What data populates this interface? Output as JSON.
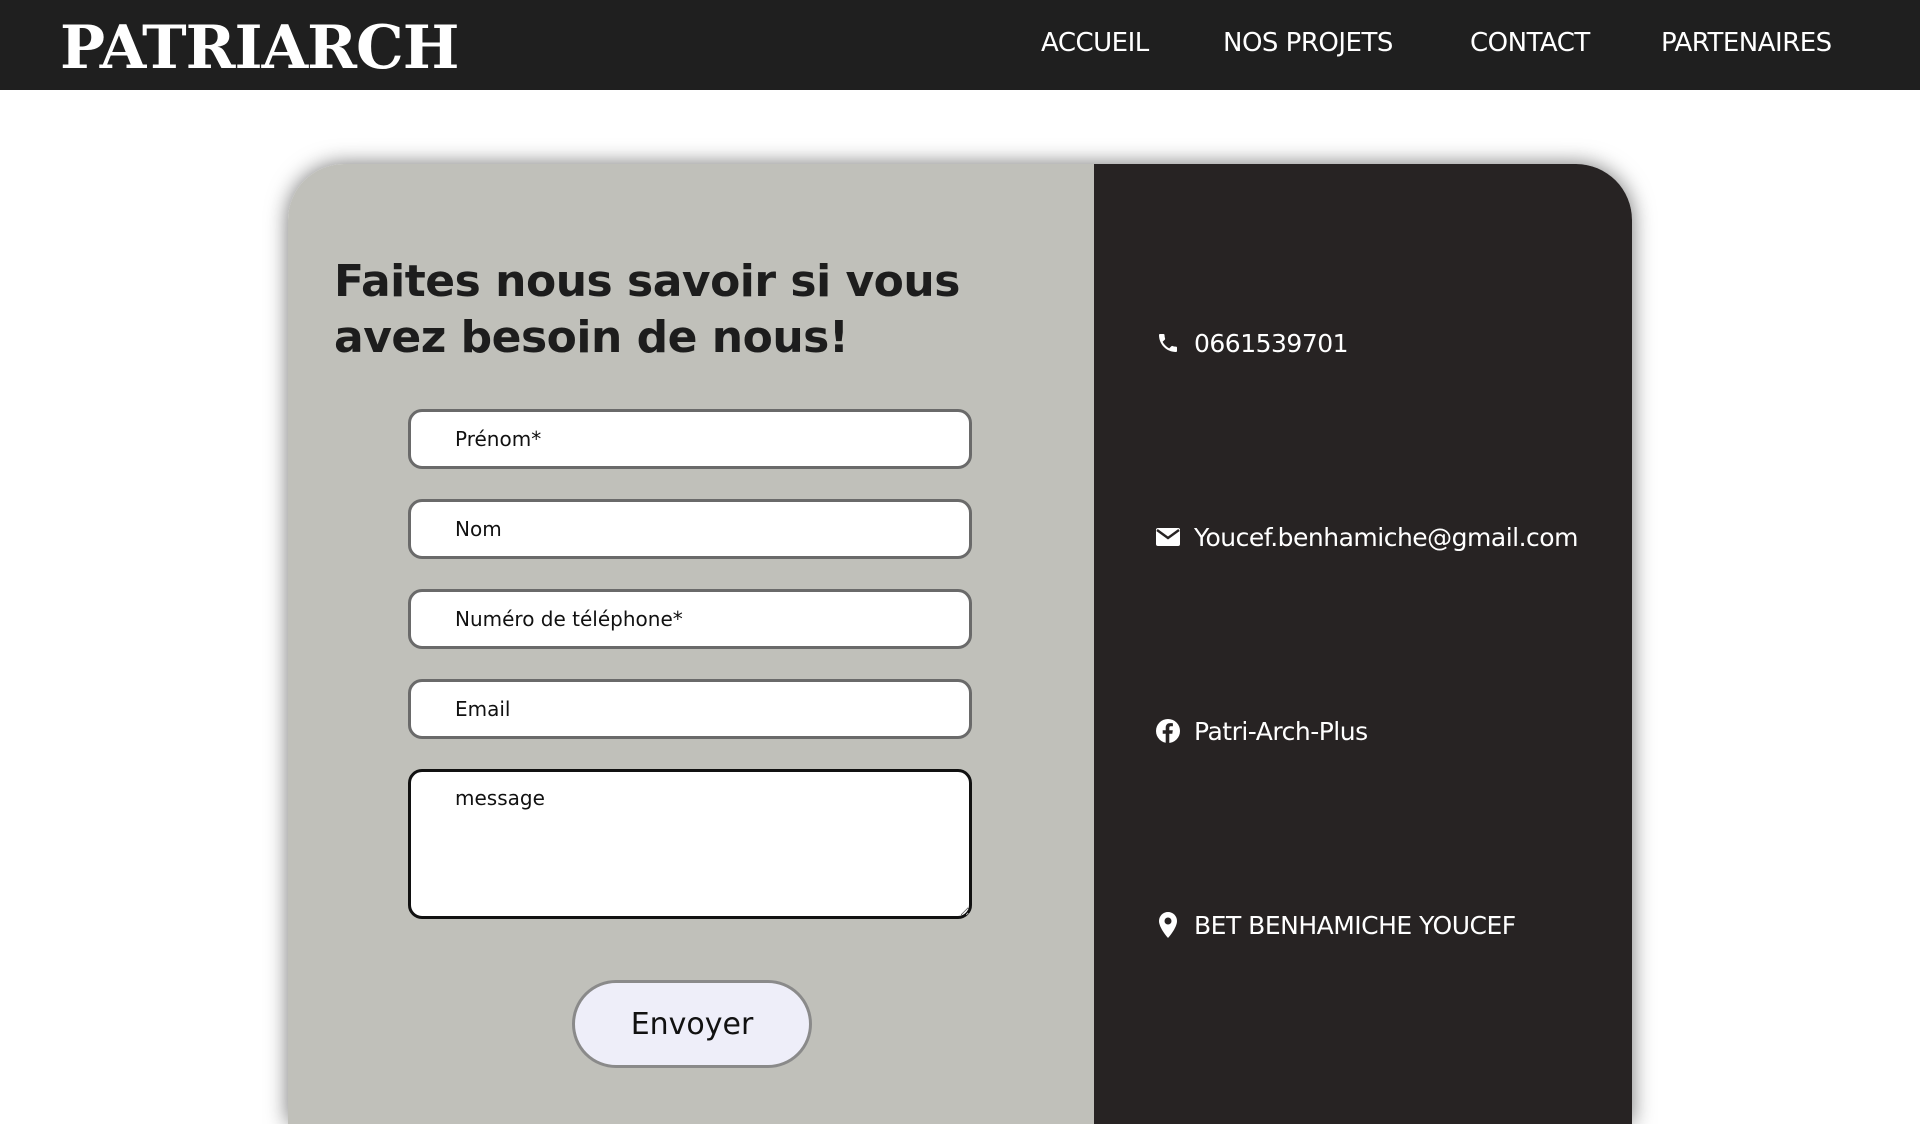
{
  "header": {
    "logo": "PATRIARCH",
    "nav": [
      "ACCUEIL",
      "NOS PROJETS",
      "CONTACT",
      "PARTENAIRES"
    ]
  },
  "form": {
    "heading": "Faites nous savoir si vous avez besoin de nous!",
    "fields": {
      "prenom": "Prénom*",
      "nom": "Nom",
      "telephone": "Numéro de téléphone*",
      "email": "Email",
      "message": "message"
    },
    "submit_label": "Envoyer"
  },
  "contact": {
    "phone": "0661539701",
    "email": "Youcef.benhamiche@gmail.com",
    "facebook": "Patri-Arch-Plus",
    "location": "BET BENHAMICHE YOUCEF",
    "icons": [
      "phone-icon",
      "mail-icon",
      "facebook-icon",
      "location-pin-icon"
    ]
  },
  "colors": {
    "topbar": "#1f1f1f",
    "form_panel": "#c0c0ba",
    "info_panel": "#272323",
    "button": "#eeeef9"
  }
}
